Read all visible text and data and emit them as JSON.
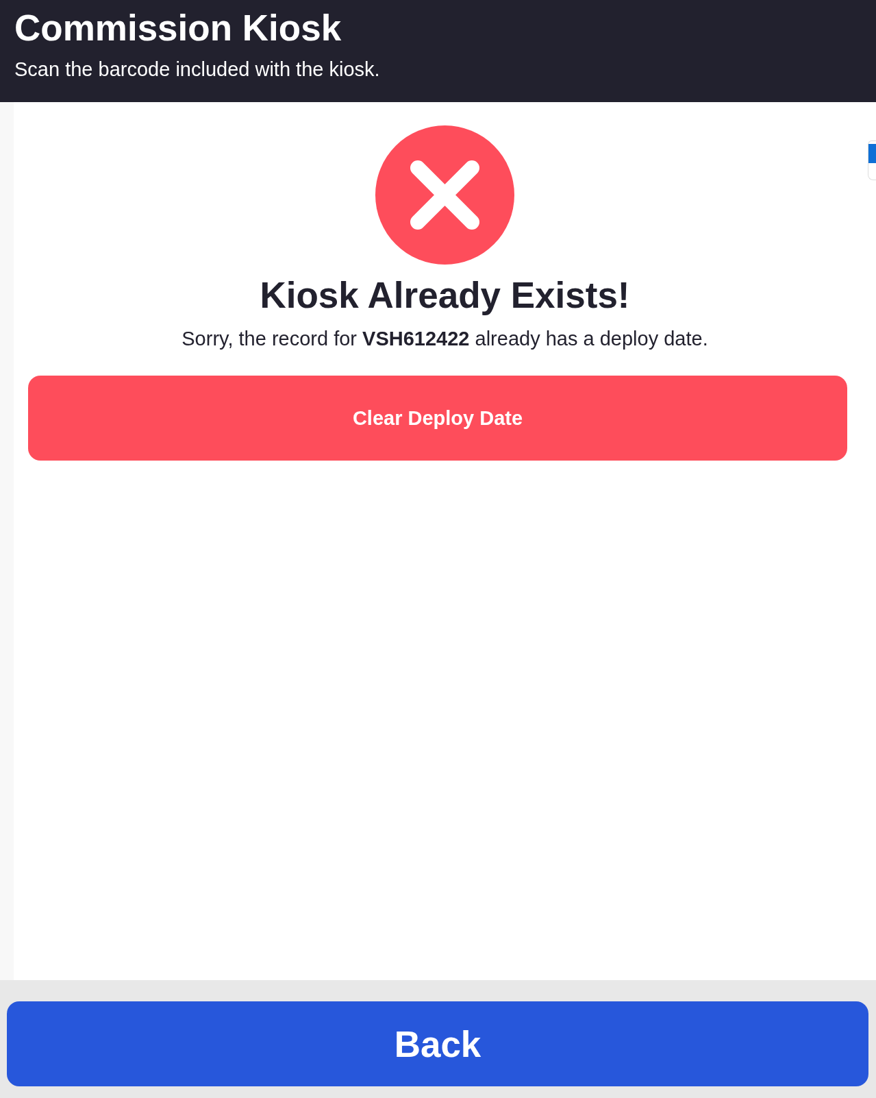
{
  "header": {
    "title": "Commission Kiosk",
    "subtitle": "Scan the barcode included with the kiosk."
  },
  "result": {
    "kind": "error",
    "title": "Kiosk Already Exists!",
    "message": "Sorry, the record for **VSH612422** already has a deploy date.",
    "action": "Clear Deploy Date"
  },
  "footer": {
    "button": "Back"
  }
}
